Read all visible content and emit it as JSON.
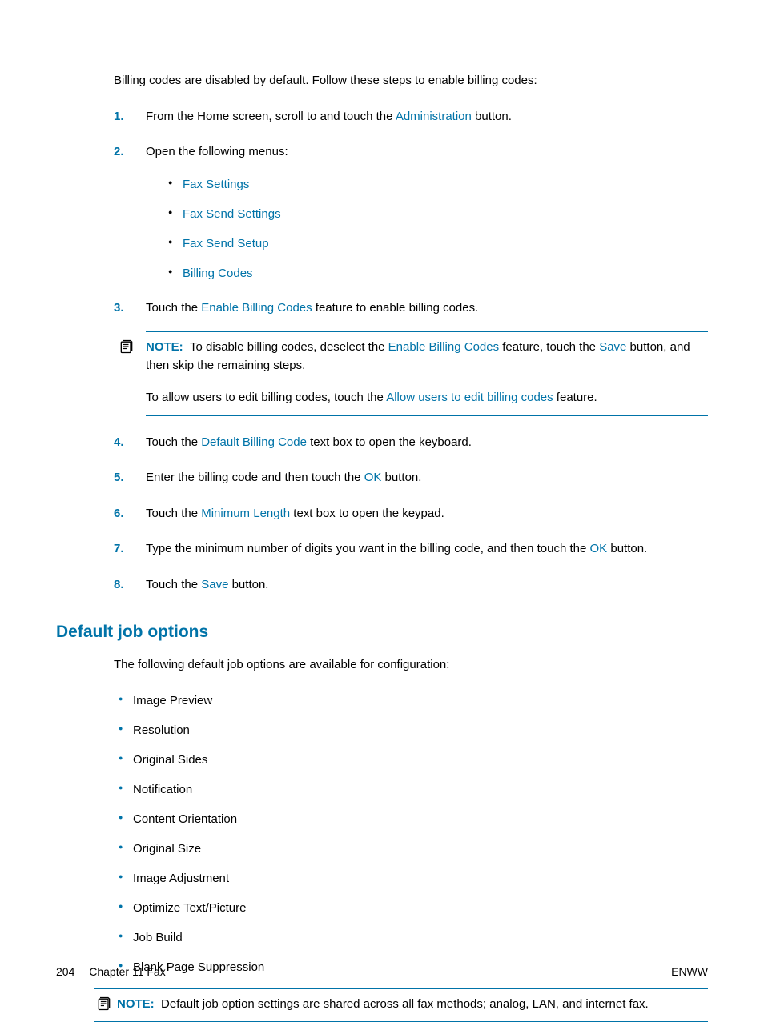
{
  "intro": "Billing codes are disabled by default. Follow these steps to enable billing codes:",
  "steps": {
    "s1": {
      "num": "1.",
      "pre": "From the Home screen, scroll to and touch the ",
      "link": "Administration",
      "post": " button."
    },
    "s2": {
      "num": "2.",
      "text": "Open the following menus:",
      "items": [
        "Fax Settings",
        "Fax Send Settings",
        "Fax Send Setup",
        "Billing Codes"
      ]
    },
    "s3": {
      "num": "3.",
      "pre": "Touch the ",
      "link": "Enable Billing Codes",
      "post": " feature to enable billing codes."
    },
    "note1": {
      "label": "NOTE:",
      "l1_pre": "To disable billing codes, deselect the ",
      "l1_link1": "Enable Billing Codes",
      "l1_mid": " feature, touch the ",
      "l1_link2": "Save",
      "l1_post": " button, and then skip the remaining steps.",
      "l2_pre": "To allow users to edit billing codes, touch the ",
      "l2_link": "Allow users to edit billing codes",
      "l2_post": " feature."
    },
    "s4": {
      "num": "4.",
      "pre": "Touch the ",
      "link": "Default Billing Code",
      "post": " text box to open the keyboard."
    },
    "s5": {
      "num": "5.",
      "pre": "Enter the billing code and then touch the ",
      "link": "OK",
      "post": " button."
    },
    "s6": {
      "num": "6.",
      "pre": "Touch the ",
      "link": "Minimum Length",
      "post": " text box to open the keypad."
    },
    "s7": {
      "num": "7.",
      "pre": "Type the minimum number of digits you want in the billing code, and then touch the ",
      "link": "OK",
      "post": " button."
    },
    "s8": {
      "num": "8.",
      "pre": "Touch the ",
      "link": "Save",
      "post": " button."
    }
  },
  "section2": {
    "heading": "Default job options",
    "intro": "The following default job options are available for configuration:",
    "items": [
      "Image Preview",
      "Resolution",
      "Original Sides",
      "Notification",
      "Content Orientation",
      "Original Size",
      "Image Adjustment",
      "Optimize Text/Picture",
      "Job Build",
      "Blank Page Suppression"
    ],
    "note": {
      "label": "NOTE:",
      "text": "Default job option settings are shared across all fax methods; analog, LAN, and internet fax."
    }
  },
  "footer": {
    "page": "204",
    "chapter": "Chapter 11   Fax",
    "right": "ENWW"
  }
}
